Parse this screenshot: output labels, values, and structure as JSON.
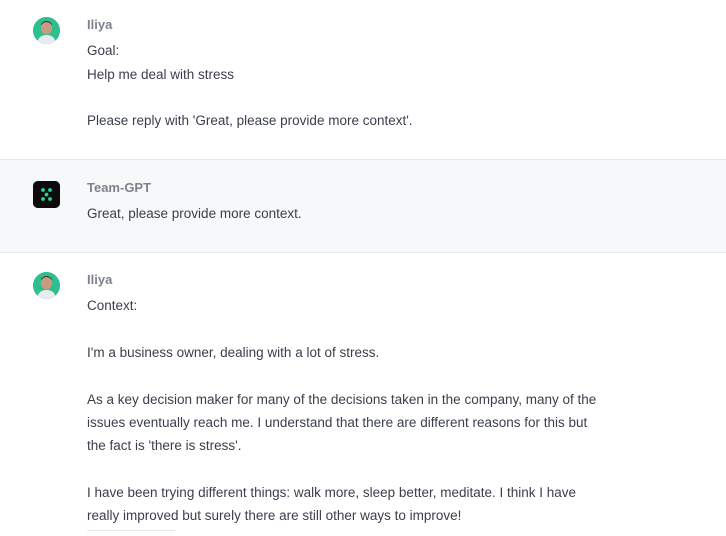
{
  "messages": [
    {
      "author": "Iliya",
      "lines": [
        "Goal:",
        "Help me deal with stress",
        "",
        "Please reply with 'Great, please provide more context'."
      ]
    },
    {
      "author": "Team-GPT",
      "lines": [
        "Great, please provide more context."
      ]
    },
    {
      "author": "Iliya",
      "lines": [
        "Context:",
        "",
        "I'm a business owner, dealing with a lot of stress.",
        "",
        "As a key decision maker for many of the decisions taken in the company, many of the",
        "issues eventually reach me. I understand that there are different reasons for this but",
        "the fact is 'there is stress'.",
        "",
        "I have been trying different things: walk more, sleep better, meditate. I think I have",
        "really improved but surely there are still other ways to improve!"
      ]
    }
  ],
  "colors": {
    "user_avatar_bg": "#2fbf8f",
    "bot_avatar_bg": "#0c0c0c",
    "bot_avatar_dots": "#22d3a6",
    "bot_row_bg": "#f7f8fa"
  },
  "icons": {
    "user_avatar": "user-photo-avatar",
    "bot_avatar": "team-gpt-logo-icon"
  }
}
